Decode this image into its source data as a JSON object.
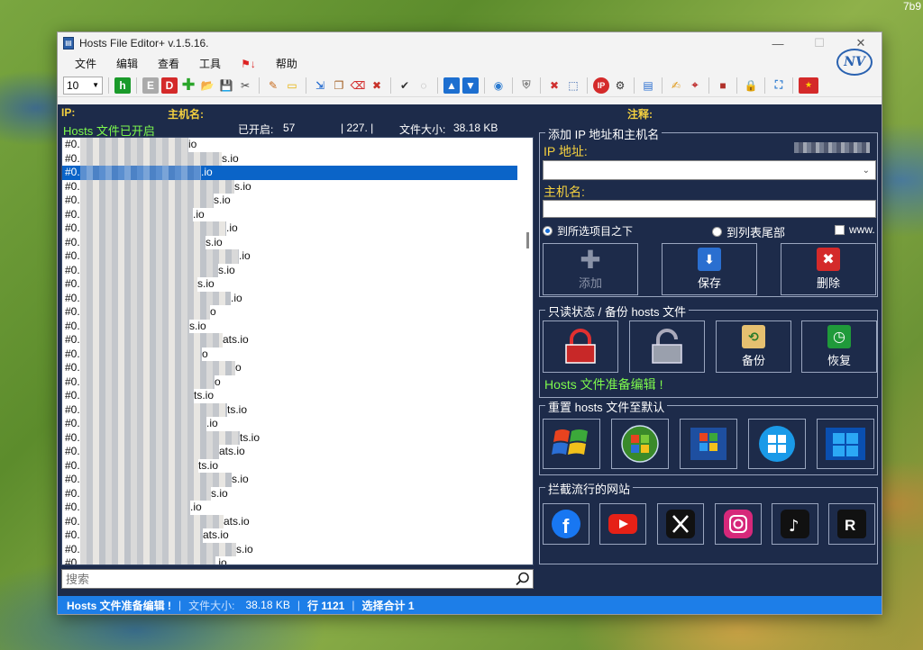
{
  "desktop": {
    "corner_text": "7b9"
  },
  "window": {
    "title": "Hosts File Editor+ v.1.5.16.",
    "menu": [
      "文件",
      "编辑",
      "查看",
      "工具",
      "帮助"
    ],
    "logo_text": "NV"
  },
  "toolbar": {
    "font_size": "10"
  },
  "columns": {
    "ip": "IP:",
    "hostname": "主机名:",
    "comment": "注释:"
  },
  "status_line": {
    "enabled_text": "Hosts 文件已开启",
    "enabled_count_label": "已开启:",
    "enabled_count": "57",
    "total": "| 227. |",
    "size_label": "文件大小:",
    "size_value": "38.18 KB"
  },
  "hosts": [
    {
      "prefix": "#0.0.0.0",
      "tail": "io"
    },
    {
      "prefix": "#0.",
      "tail": "s.io"
    },
    {
      "prefix": "#0.",
      "tail": ".io",
      "selected": true
    },
    {
      "prefix": "#0.",
      "tail": "s.io"
    },
    {
      "prefix": "#0.",
      "tail": "s.io"
    },
    {
      "prefix": "#0.",
      "tail": ".io"
    },
    {
      "prefix": "#0.",
      "tail": ".io"
    },
    {
      "prefix": "#0.",
      "tail": "s.io"
    },
    {
      "prefix": "#0.",
      "tail": ".io"
    },
    {
      "prefix": "#0.",
      "tail": "s.io"
    },
    {
      "prefix": "#0.",
      "tail": "s.io"
    },
    {
      "prefix": "#0.",
      "tail": ".io"
    },
    {
      "prefix": "#0.",
      "tail": "o"
    },
    {
      "prefix": "#0.",
      "tail": "s.io"
    },
    {
      "prefix": "#0.",
      "tail": "ats.io"
    },
    {
      "prefix": "#0.",
      "tail": "o"
    },
    {
      "prefix": "#0.",
      "tail": "o"
    },
    {
      "prefix": "#0.",
      "tail": "o"
    },
    {
      "prefix": "#0.",
      "tail": "ts.io"
    },
    {
      "prefix": "#0.",
      "tail": "ts.io"
    },
    {
      "prefix": "#0.",
      "tail": ".io"
    },
    {
      "prefix": "#0.",
      "tail": "ts.io"
    },
    {
      "prefix": "#0.",
      "tail": "ats.io"
    },
    {
      "prefix": "#0.",
      "tail": "ts.io"
    },
    {
      "prefix": "#0.",
      "tail": "s.io"
    },
    {
      "prefix": "#0.",
      "tail": "s.io"
    },
    {
      "prefix": "#0.",
      "tail": ".io"
    },
    {
      "prefix": "#0.",
      "tail": "ats.io"
    },
    {
      "prefix": "#0.",
      "tail": "ats.io"
    },
    {
      "prefix": "#0.",
      "tail": "s.io"
    },
    {
      "prefix": "#0.",
      "tail": ".io"
    }
  ],
  "search": {
    "placeholder": "搜索"
  },
  "add_panel": {
    "title": "添加 IP 地址和主机名",
    "ip_label": "IP 地址:",
    "host_label": "主机名:",
    "radio_below": "到所选项目之下",
    "radio_end": "到列表尾部",
    "www_label": "www.",
    "btn_add": "添加",
    "btn_save": "保存",
    "btn_delete": "删除"
  },
  "readonly_panel": {
    "title": "只读状态 / 备份 hosts 文件",
    "btn_backup": "备份",
    "btn_restore": "恢复",
    "ready_text": "Hosts 文件准备编辑 !"
  },
  "reset_panel": {
    "title": "重置 hosts 文件至默认",
    "os": [
      "XP",
      "Vista",
      "Windows 7",
      "Windows 8",
      "Windows 10, 11"
    ]
  },
  "block_panel": {
    "title": "拦截流行的网站",
    "sites": [
      "facebook",
      "youtube",
      "x",
      "instagram",
      "tiktok",
      "reddit"
    ]
  },
  "statusbar": {
    "state": "Hosts 文件准备编辑 !",
    "size_label": "文件大小:",
    "size_value": "38.18 KB",
    "line": "行 1121",
    "selected": "选择合计 1"
  },
  "colors": {
    "dark_bg": "#1d2b4a",
    "accent_yellow": "#f4d03f",
    "green_text": "#7dfa4d",
    "status_blue": "#1d7ee8"
  }
}
